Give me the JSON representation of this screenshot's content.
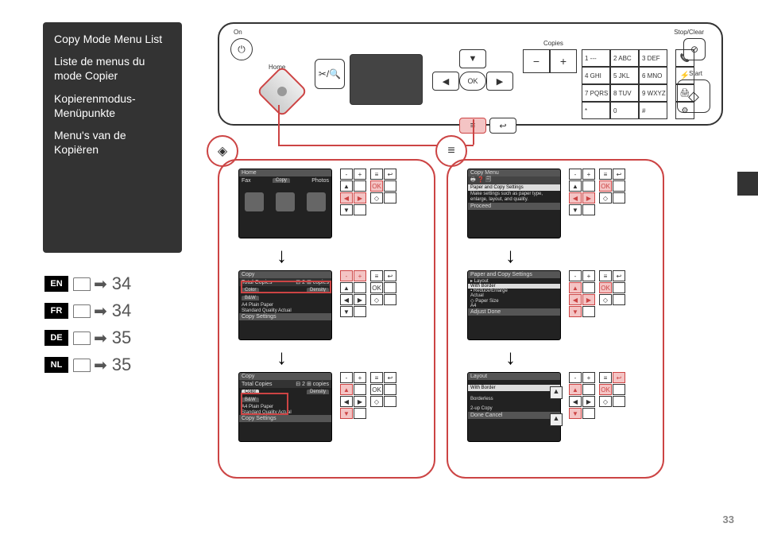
{
  "sidebar": {
    "titles": [
      "Copy Mode Menu List",
      "Liste de menus du mode Copier",
      "Kopierenmodus-Menüpunkte",
      "Menu's van de Kopiëren"
    ]
  },
  "refs": [
    {
      "lang": "EN",
      "page": "34"
    },
    {
      "lang": "FR",
      "page": "34"
    },
    {
      "lang": "DE",
      "page": "35"
    },
    {
      "lang": "NL",
      "page": "35"
    }
  ],
  "panel": {
    "on": "On",
    "home": "Home",
    "menu": "Menu",
    "back": "Back",
    "ok": "OK",
    "copies": "Copies",
    "minus": "−",
    "plus": "+",
    "stop": "Stop/Clear",
    "start": "Start",
    "start_sym": "◇",
    "keys": [
      "1 ---",
      "2 ABC",
      "3 DEF",
      "4 GHI",
      "5 JKL",
      "6 MNO",
      "7 PQRS",
      "8 TUV",
      "9 WXYZ",
      "*",
      "0",
      "#"
    ],
    "side": [
      "📞",
      "⚡",
      "🖨",
      "⚙"
    ]
  },
  "icons": {
    "home": "◈",
    "menu": "≡"
  },
  "screens": {
    "home": {
      "bar": "Home",
      "tabs": [
        "Fax",
        "Copy",
        "Photos"
      ]
    },
    "copy": {
      "bar": "Copy",
      "total": "Total Copies",
      "count": "2",
      "copies_lbl": "copies",
      "color": "Color",
      "density": "Density",
      "bw": "B&W",
      "paper": "A4            Plain Paper",
      "quality": "Standard Quality Actual",
      "footer": "Copy   Settings"
    },
    "copymenu": {
      "bar": "Copy Menu",
      "text": "Paper and Copy Settings",
      "sub": "Make settings such as paper type, enlarge, layout, and quality.",
      "proceed": "Proceed"
    },
    "pcs": {
      "bar": "Paper and Copy Settings",
      "items": [
        "▸ Layout",
        "   With Border",
        "▪ Reduce/Enlarge",
        "   Actual",
        "◇ Paper Size",
        "   A4"
      ],
      "footer": "Adjust   Done"
    },
    "layout": {
      "bar": "Layout",
      "items": [
        "With Border",
        "Borderless",
        "2-up Copy"
      ],
      "footer": "Done   Cancel",
      "arrows": [
        "▲",
        "▲"
      ]
    }
  },
  "page_number": "33"
}
